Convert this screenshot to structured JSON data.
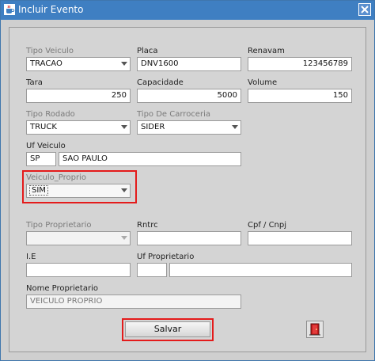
{
  "window": {
    "title": "Incluir Evento",
    "app_icon": "java-cup-icon",
    "close_icon": "close-icon"
  },
  "form": {
    "tipo_veiculo": {
      "label": "Tipo Veiculo",
      "value": "TRACAO"
    },
    "placa": {
      "label": "Placa",
      "value": "DNV1600"
    },
    "renavam": {
      "label": "Renavam",
      "value": "123456789"
    },
    "tara": {
      "label": "Tara",
      "value": "250"
    },
    "capacidade": {
      "label": "Capacidade",
      "value": "5000"
    },
    "volume": {
      "label": "Volume",
      "value": "150"
    },
    "tipo_rodado": {
      "label": "Tipo Rodado",
      "value": "TRUCK"
    },
    "tipo_carroceria": {
      "label": "Tipo De Carroceria",
      "value": "SIDER"
    },
    "uf_veiculo": {
      "label": "Uf Veiculo",
      "uf": "SP",
      "name": "SAO PAULO"
    },
    "veiculo_proprio": {
      "label": "Veiculo_Proprio",
      "value": "SIM"
    },
    "tipo_proprietario": {
      "label": "Tipo Proprietario",
      "value": ""
    },
    "rntrc": {
      "label": "Rntrc",
      "value": ""
    },
    "cpf_cnpj": {
      "label": "Cpf / Cnpj",
      "value": ""
    },
    "ie": {
      "label": "I.E",
      "value": ""
    },
    "uf_proprietario": {
      "label": "Uf Proprietario",
      "uf": "",
      "name": ""
    },
    "nome_proprietario": {
      "label": "Nome Proprietario",
      "value": "VEICULO PROPRIO"
    }
  },
  "actions": {
    "save_label": "Salvar",
    "exit_icon": "exit-door-icon"
  },
  "colors": {
    "titlebar": "#3f7fc2",
    "highlight": "#e41b1b",
    "panel": "#d4d4d4"
  }
}
